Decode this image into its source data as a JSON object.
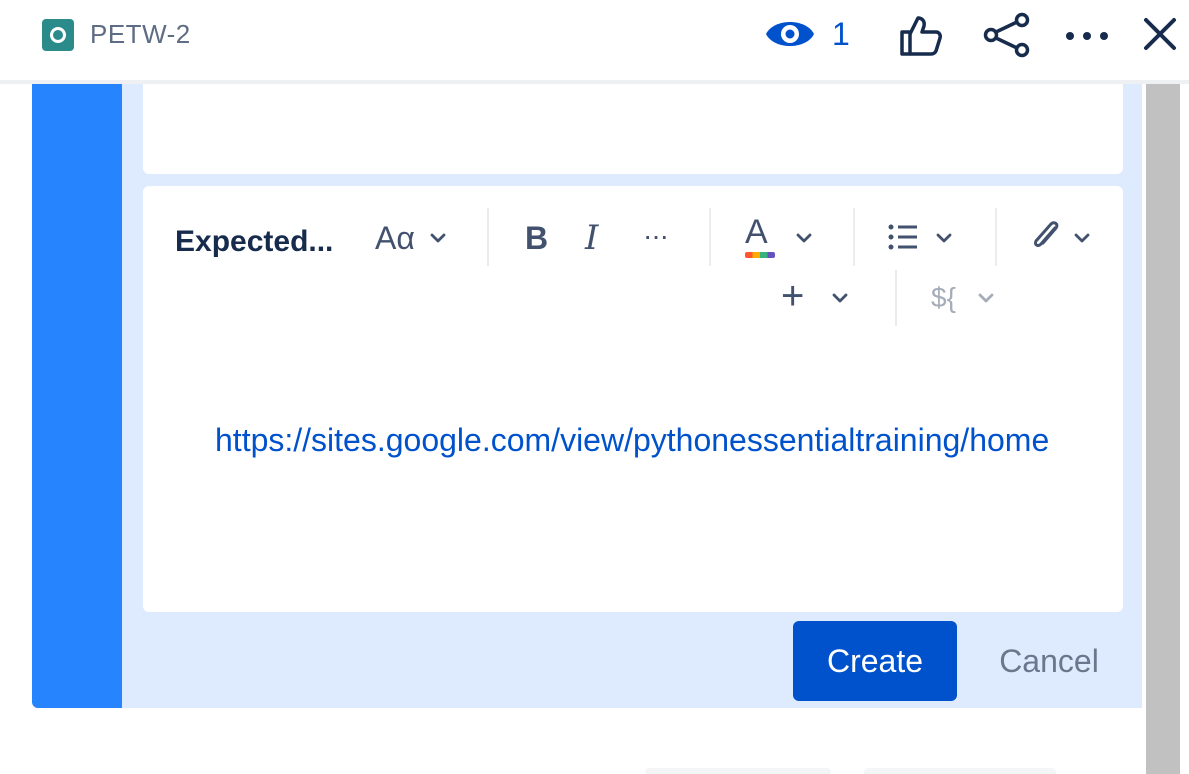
{
  "header": {
    "issue_key": "PETW-2",
    "issue_type_icon": "issue-type-icon",
    "watchers_count": "1",
    "actions": [
      "watch-icon",
      "like-icon",
      "share-icon",
      "more-icon",
      "close-icon"
    ]
  },
  "editor": {
    "toolbar": {
      "text_style": "Expected...",
      "font_label": "Aα",
      "bold_label": "B",
      "italic_label": "I",
      "more_label": "···",
      "text_color_label": "A",
      "insert_label": "+",
      "placeholder_label": "${"
    },
    "content": {
      "link_text": "https://sites.google.com/view/pythonessentialtraining/home"
    }
  },
  "footer": {
    "create_label": "Create",
    "cancel_label": "Cancel"
  },
  "colors": {
    "accent": "#2684ff",
    "primary_button": "#0052cc",
    "panel_background": "#deebff",
    "issue_type": "#2b8a8a"
  }
}
